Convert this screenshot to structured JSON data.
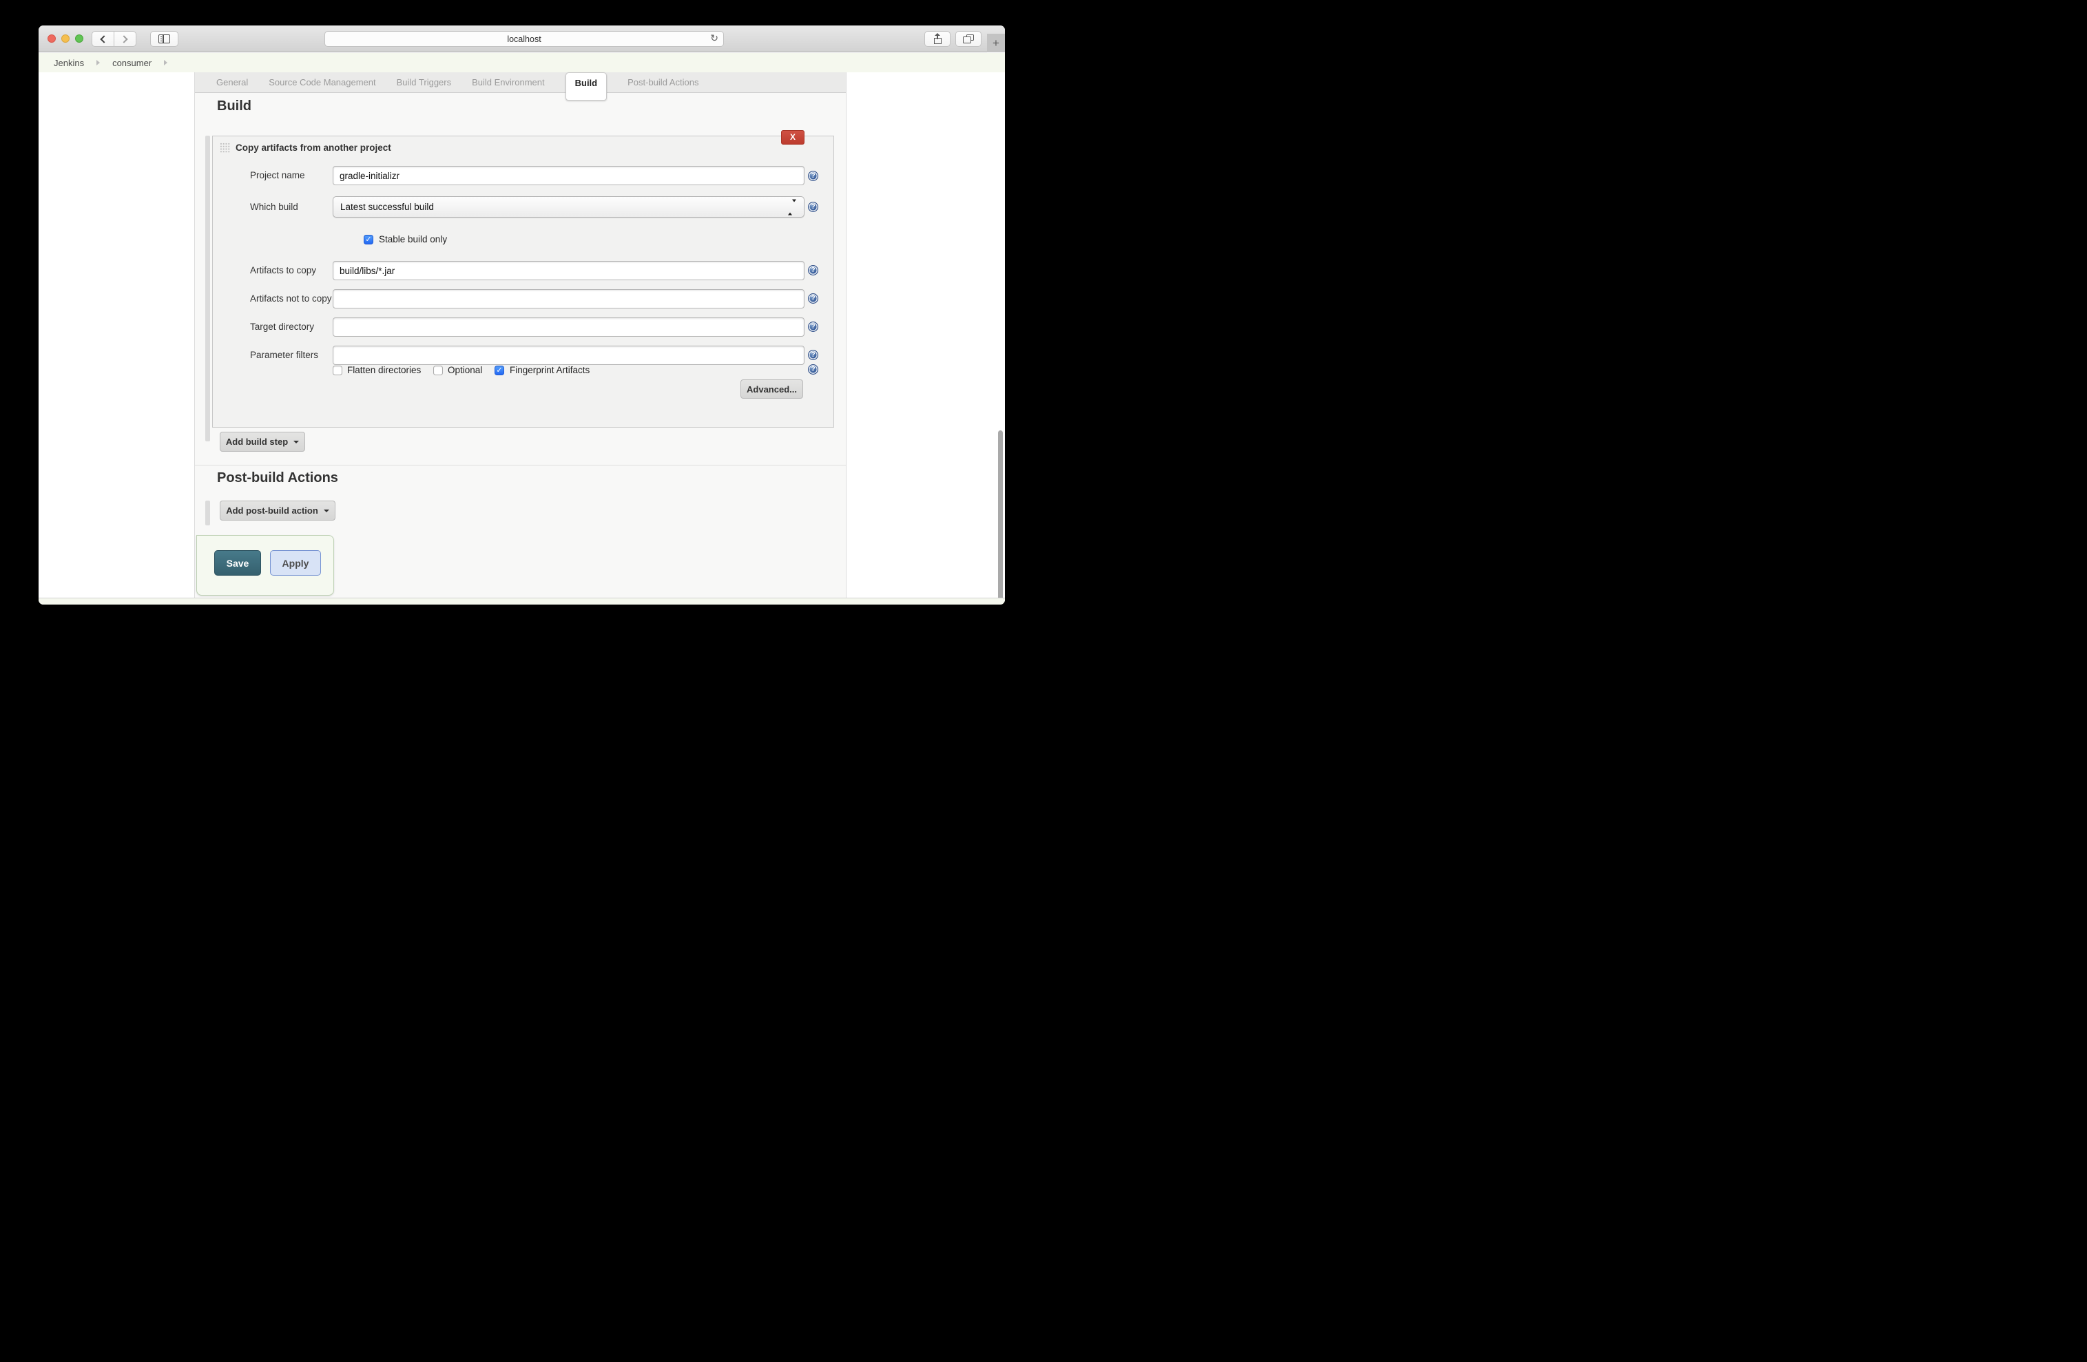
{
  "browser": {
    "url_text": "localhost",
    "toolbar": {
      "refresh_glyph": "↻",
      "plus_label": "+"
    },
    "breadcrumb": {
      "items": [
        "Jenkins",
        "consumer"
      ]
    }
  },
  "tabs": [
    "General",
    "Source Code Management",
    "Build Triggers",
    "Build Environment",
    "Build",
    "Post-build Actions"
  ],
  "active_tab": "Build",
  "build": {
    "heading": "Build",
    "step": {
      "title": "Copy artifacts from another project",
      "delete_label": "X",
      "fields": [
        {
          "label": "Project name",
          "value": "gradle-initializr",
          "type": "text"
        },
        {
          "label": "Which build",
          "value": "Latest successful build",
          "type": "select"
        },
        {
          "label": "Artifacts to copy",
          "value": "build/libs/*.jar",
          "type": "text"
        },
        {
          "label": "Artifacts not to copy",
          "value": "",
          "type": "text"
        },
        {
          "label": "Target directory",
          "value": "",
          "type": "text"
        },
        {
          "label": "Parameter filters",
          "value": "",
          "type": "text"
        }
      ],
      "stable_build_only": {
        "label": "Stable build only",
        "checked": true
      },
      "options": [
        {
          "label": "Flatten directories",
          "checked": false
        },
        {
          "label": "Optional",
          "checked": false
        },
        {
          "label": "Fingerprint Artifacts",
          "checked": true
        }
      ],
      "advanced_label": "Advanced...",
      "help_glyph": "?",
      "check_glyph": "✓"
    },
    "add_build_step_label": "Add build step"
  },
  "post_build": {
    "heading": "Post-build Actions",
    "add_action_label": "Add post-build action"
  },
  "actions": {
    "save_label": "Save",
    "apply_label": "Apply"
  },
  "colors": {
    "delete_red": "#c4453a",
    "save_teal": "#3c6a77",
    "apply_blue_bg": "#d8e3f6",
    "apply_blue_border": "#7693d2",
    "checkbox_blue": "#2f7cf6",
    "help_blue": "#33568f",
    "breadcrumb_bg": "#f5f8ee",
    "tabstrip_bg": "#eaeae9"
  }
}
